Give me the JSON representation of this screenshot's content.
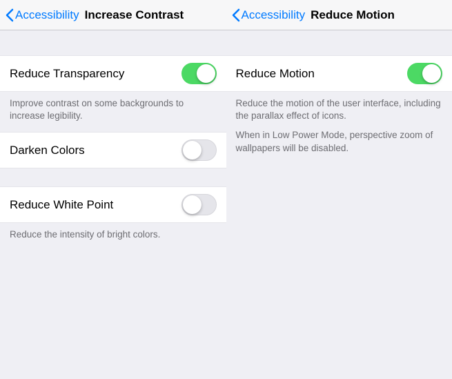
{
  "left": {
    "back_label": "Accessibility",
    "title": "Increase Contrast",
    "rows": {
      "reduce_transparency": {
        "label": "Reduce Transparency",
        "on": true
      },
      "darken_colors": {
        "label": "Darken Colors",
        "on": false
      },
      "reduce_white_point": {
        "label": "Reduce White Point",
        "on": false
      }
    },
    "footer_transparency": "Improve contrast on some backgrounds to increase legibility.",
    "footer_white_point": "Reduce the intensity of bright colors."
  },
  "right": {
    "back_label": "Accessibility",
    "title": "Reduce Motion",
    "rows": {
      "reduce_motion": {
        "label": "Reduce Motion",
        "on": true
      }
    },
    "footer_p1": "Reduce the motion of the user interface, including the parallax effect of icons.",
    "footer_p2": "When in Low Power Mode, perspective zoom of wallpapers will be disabled."
  },
  "colors": {
    "tint": "#007aff",
    "switch_on": "#4cd964"
  }
}
